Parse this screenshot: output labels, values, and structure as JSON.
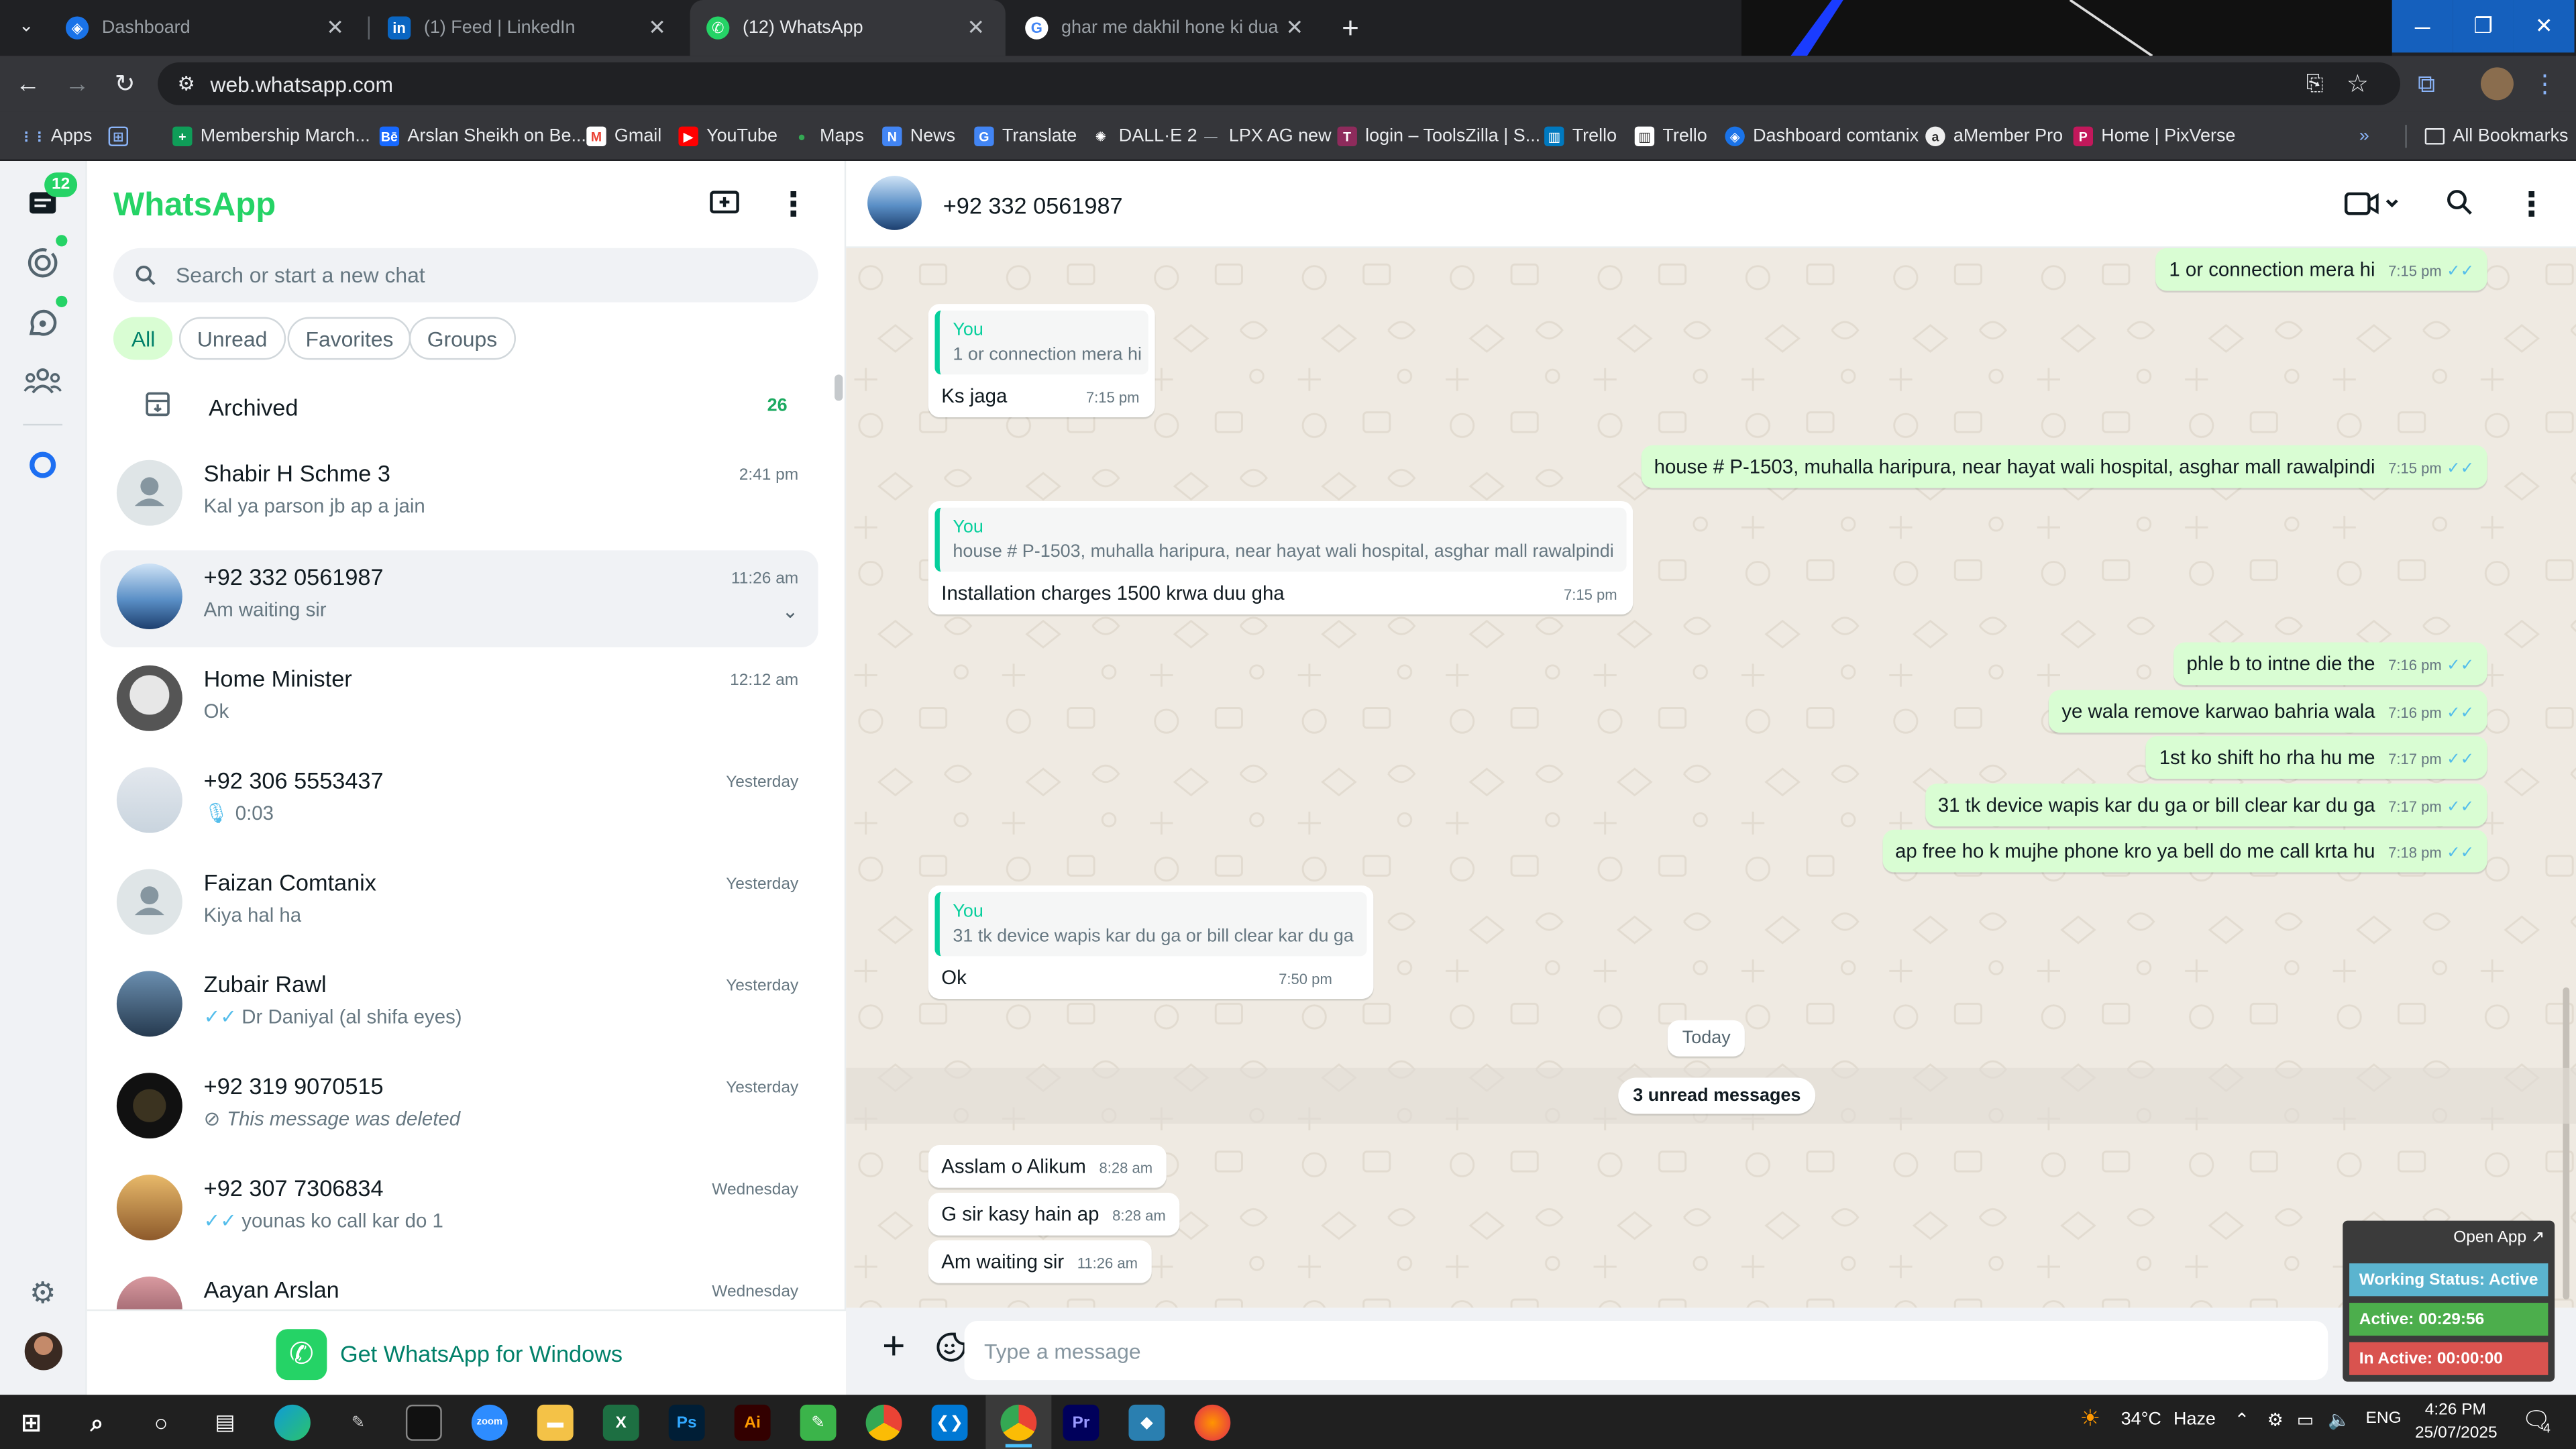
{
  "browser": {
    "tabs": [
      {
        "title": "Dashboard",
        "icon": "dashboard-favicon",
        "color": "#1a73e8"
      },
      {
        "title": "(1) Feed | LinkedIn",
        "icon": "linkedin-favicon",
        "color": "#0a66c2"
      },
      {
        "title": "(12) WhatsApp",
        "icon": "whatsapp-favicon",
        "color": "#25d366"
      },
      {
        "title": "ghar me dakhil hone ki dua - G",
        "icon": "google-favicon",
        "color": "#ffffff"
      }
    ],
    "url": "web.whatsapp.com",
    "bookmarks": [
      {
        "label": "Apps"
      },
      {
        "label": "Membership March..."
      },
      {
        "label": "Arslan Sheikh on Be..."
      },
      {
        "label": "Gmail"
      },
      {
        "label": "YouTube"
      },
      {
        "label": "Maps"
      },
      {
        "label": "News"
      },
      {
        "label": "Translate"
      },
      {
        "label": "DALL·E 2"
      },
      {
        "label": "LPX AG new"
      },
      {
        "label": "login – ToolsZilla | S..."
      },
      {
        "label": "Trello"
      },
      {
        "label": "Trello"
      },
      {
        "label": "Dashboard comtanix"
      },
      {
        "label": "aMember Pro"
      },
      {
        "label": "Home | PixVerse"
      }
    ],
    "all_bookmarks": "All Bookmarks"
  },
  "whatsapp": {
    "brand": "WhatsApp",
    "unread_badge": "12",
    "search_placeholder": "Search or start a new chat",
    "filters": [
      "All",
      "Unread",
      "Favorites",
      "Groups"
    ],
    "archived_label": "Archived",
    "archived_count": "26",
    "chats": [
      {
        "name": "Shabir H  Schme 3",
        "time": "2:41 pm",
        "preview": "Kal ya parson jb ap a jain",
        "prefix": "",
        "avatar": "default"
      },
      {
        "name": "+92 332 0561987",
        "time": "11:26 am",
        "preview": "Am waiting sir",
        "prefix": "",
        "avatar": "photo-blue",
        "selected": true
      },
      {
        "name": "Home Minister",
        "time": "12:12 am",
        "preview": "Ok",
        "prefix": "",
        "avatar": "photo-gray"
      },
      {
        "name": "+92 306 5553437",
        "time": "Yesterday",
        "preview": "0:03",
        "prefix": "mic",
        "avatar": "photo-light"
      },
      {
        "name": "Faizan Comtanix",
        "time": "Yesterday",
        "preview": "Kiya hal ha",
        "prefix": "",
        "avatar": "default"
      },
      {
        "name": "Zubair Rawl",
        "time": "Yesterday",
        "preview": "Dr Daniyal (al shifa eyes)",
        "prefix": "ticks",
        "avatar": "photo-dark"
      },
      {
        "name": "+92 319 9070515",
        "time": "Yesterday",
        "preview": "This message was deleted",
        "prefix": "deleted",
        "avatar": "photo-black"
      },
      {
        "name": "+92 307 7306834",
        "time": "Wednesday",
        "preview": "younas ko call kar do 1",
        "prefix": "ticks",
        "avatar": "photo-warm"
      },
      {
        "name": "Aayan Arslan",
        "time": "Wednesday",
        "preview": "",
        "prefix": "",
        "avatar": "photo-pink"
      }
    ],
    "get_app": "Get WhatsApp for Windows",
    "chat_title": "+92 332 0561987",
    "messages": [
      {
        "dir": "out",
        "text": "1 or connection mera hi",
        "time": "7:15 pm"
      },
      {
        "dir": "in",
        "quote_from": "You",
        "quote": "1 or connection mera hi",
        "text": "Ks jaga",
        "time": "7:15 pm"
      },
      {
        "dir": "out",
        "text": "house # P-1503, muhalla haripura, near hayat wali hospital, asghar mall rawalpindi",
        "time": "7:15 pm"
      },
      {
        "dir": "in",
        "quote_from": "You",
        "quote": "house # P-1503, muhalla haripura, near hayat wali hospital, asghar mall rawalpindi",
        "text": "Installation charges 1500 krwa duu gha",
        "time": "7:15 pm"
      },
      {
        "dir": "out",
        "text": "phle b to intne die the",
        "time": "7:16 pm"
      },
      {
        "dir": "out",
        "text": "ye wala remove karwao bahria wala",
        "time": "7:16 pm"
      },
      {
        "dir": "out",
        "text": "1st ko shift ho rha hu me",
        "time": "7:17 pm"
      },
      {
        "dir": "out",
        "text": "31 tk device wapis kar du ga or bill clear kar du ga",
        "time": "7:17 pm"
      },
      {
        "dir": "out",
        "text": "ap free ho k mujhe phone kro ya bell do me call krta hu",
        "time": "7:18 pm"
      },
      {
        "dir": "in",
        "quote_from": "You",
        "quote": "31 tk device wapis kar du ga or bill clear kar du ga",
        "text": "Ok",
        "time": "7:50 pm"
      },
      {
        "dir": "in",
        "text": "Asslam o Alikum",
        "time": "8:28 am"
      },
      {
        "dir": "in",
        "text": "G sir kasy hain ap",
        "time": "8:28 am"
      },
      {
        "dir": "in",
        "text": "Am waiting sir",
        "time": "11:26 am"
      }
    ],
    "date_divider": "Today",
    "unread_divider": "3 unread messages",
    "composer_placeholder": "Type a message"
  },
  "widget": {
    "open_app": "Open App ↗",
    "working_status": "Working Status: Active",
    "active": "Active: 00:29:56",
    "inactive": "In Active: 00:00:00"
  },
  "taskbar": {
    "weather_temp": "34°C",
    "weather_desc": "Haze",
    "lang": "ENG",
    "time": "4:26 PM",
    "date": "25/07/2025",
    "notif_count": "4"
  }
}
